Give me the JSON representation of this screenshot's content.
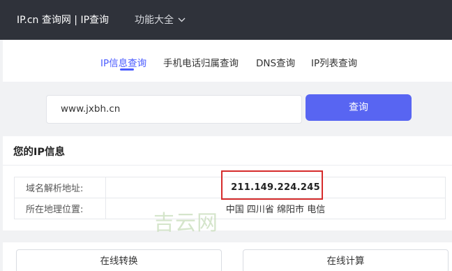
{
  "header": {
    "brand": "IP.cn 查询网 | IP查询",
    "menu_label": "功能大全"
  },
  "tabs": [
    {
      "label": "IP信息查询",
      "active": true
    },
    {
      "label": "手机电话归属查询",
      "active": false
    },
    {
      "label": "DNS查询",
      "active": false
    },
    {
      "label": "IP列表查询",
      "active": false
    }
  ],
  "search": {
    "value": "www.jxbh.cn",
    "button_label": "查询"
  },
  "info": {
    "title": "您的IP信息",
    "rows": [
      {
        "label": "域名解析地址:",
        "value": "211.149.224.245"
      },
      {
        "label": "所在地理位置:",
        "value": "中国 四川省 绵阳市 电信"
      }
    ]
  },
  "watermark": "吉云网",
  "tools": {
    "left_label": "在线转换",
    "right_label": "在线计算"
  },
  "colors": {
    "accent": "#5865f2",
    "header_bg": "#2f323a",
    "highlight": "#d62b2b"
  }
}
